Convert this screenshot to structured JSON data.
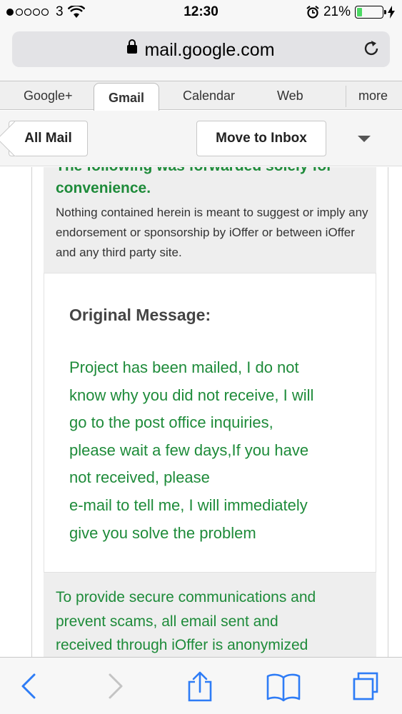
{
  "status_bar": {
    "carrier": "3",
    "time": "12:30",
    "battery_percent": "21%",
    "battery_level": 0.21,
    "icons": [
      "signal-dots-icon",
      "wifi-icon",
      "alarm-icon",
      "battery-icon",
      "charging-bolt-icon"
    ]
  },
  "browser": {
    "url": "mail.google.com",
    "icons": [
      "lock-icon",
      "reload-icon"
    ]
  },
  "gmail_tabs": [
    {
      "label": "Google+",
      "active": false
    },
    {
      "label": "Gmail",
      "active": true
    },
    {
      "label": "Calendar",
      "active": false
    },
    {
      "label": "Web",
      "active": false
    },
    {
      "label": "more",
      "active": false
    }
  ],
  "actions": {
    "back_label": "All Mail",
    "move_label": "Move to Inbox",
    "dropdown_icon": "dropdown-arrow-icon"
  },
  "message": {
    "cut_heading": "The following was forwarded solely for",
    "convenience": "convenience.",
    "disclaimer": "Nothing contained herein is meant to suggest or imply any endorsement or sponsorship by iOffer or between iOffer and any third party site.",
    "original_heading": "Original Message:",
    "original_lines": [
      "Project has been mailed, I do not",
      "know why you did not receive, I will",
      "go to the post office inquiries,",
      "please wait a few days,If you have",
      "not received, please",
      "e-mail to tell me, I will immediately",
      "give you solve the problem"
    ],
    "footer_lines": [
      "To provide secure communications and",
      "prevent scams, all email sent and",
      "received through iOffer is anonymized"
    ]
  },
  "toolbar": {
    "icons": [
      "back-arrow-icon",
      "forward-arrow-icon",
      "share-icon",
      "bookmarks-icon",
      "tabs-icon"
    ]
  },
  "colors": {
    "green_text": "#1e8b3a",
    "ios_blue": "#2e7cf6",
    "battery_green": "#4cd964"
  }
}
